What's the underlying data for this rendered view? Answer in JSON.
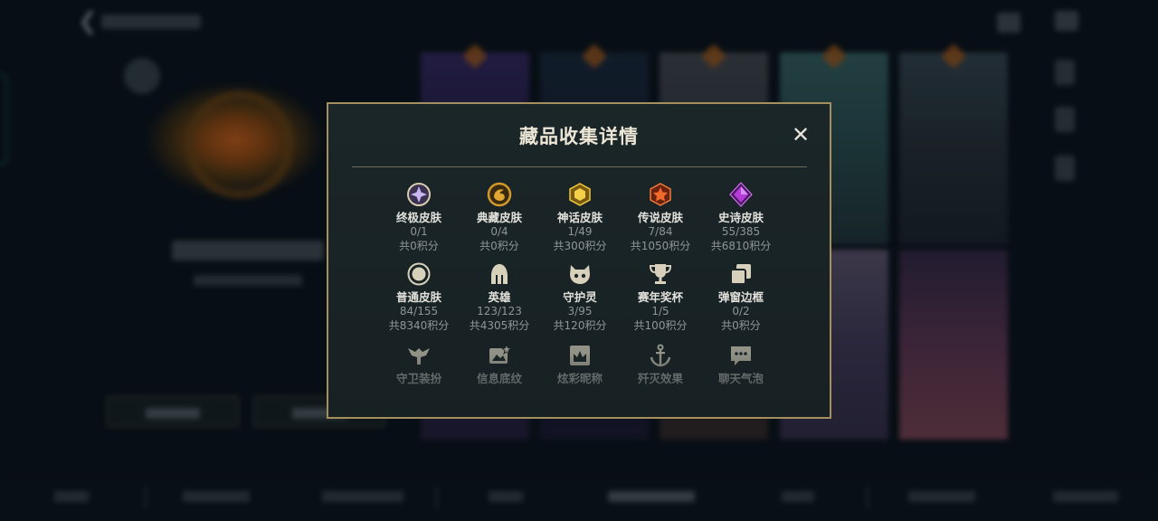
{
  "modal": {
    "title": "藏品收集详情",
    "close_glyph": "✕",
    "categories": [
      {
        "name": "终极皮肤",
        "count": "0/1",
        "points": "共0积分",
        "icon": "ultimate-skin-icon",
        "color": "#b9a4e8"
      },
      {
        "name": "典藏皮肤",
        "count": "0/4",
        "points": "共0积分",
        "icon": "legacy-dragon-icon",
        "color": "#d19a2a"
      },
      {
        "name": "神话皮肤",
        "count": "1/49",
        "points": "共300积分",
        "icon": "mythic-skin-icon",
        "color": "#e0b526"
      },
      {
        "name": "传说皮肤",
        "count": "7/84",
        "points": "共1050积分",
        "icon": "legendary-skin-icon",
        "color": "#e0572a"
      },
      {
        "name": "史诗皮肤",
        "count": "55/385",
        "points": "共6810积分",
        "icon": "epic-skin-icon",
        "color": "#b438d6"
      },
      {
        "name": "普通皮肤",
        "count": "84/155",
        "points": "共8340积分",
        "icon": "standard-skin-icon",
        "color": "#d7d0bb"
      },
      {
        "name": "英雄",
        "count": "123/123",
        "points": "共4305积分",
        "icon": "champion-helmet-icon",
        "color": "#d7d0bb"
      },
      {
        "name": "守护灵",
        "count": "3/95",
        "points": "共120积分",
        "icon": "pet-icon",
        "color": "#d7d0bb"
      },
      {
        "name": "赛年奖杯",
        "count": "1/5",
        "points": "共100积分",
        "icon": "trophy-icon",
        "color": "#d7d0bb"
      },
      {
        "name": "弹窗边框",
        "count": "0/2",
        "points": "共0积分",
        "icon": "frame-icon",
        "color": "#d7d0bb"
      },
      {
        "name": "守卫装扮",
        "icon": "ward-skin-icon",
        "color": "#8f8d82"
      },
      {
        "name": "信息底纹",
        "icon": "banner-icon",
        "color": "#8f8d82"
      },
      {
        "name": "炫彩昵称",
        "icon": "nickname-icon",
        "color": "#8f8d82"
      },
      {
        "name": "歼灭效果",
        "icon": "finisher-icon",
        "color": "#8f8d82"
      },
      {
        "name": "聊天气泡",
        "icon": "chat-bubble-icon",
        "color": "#8f8d82"
      }
    ]
  }
}
